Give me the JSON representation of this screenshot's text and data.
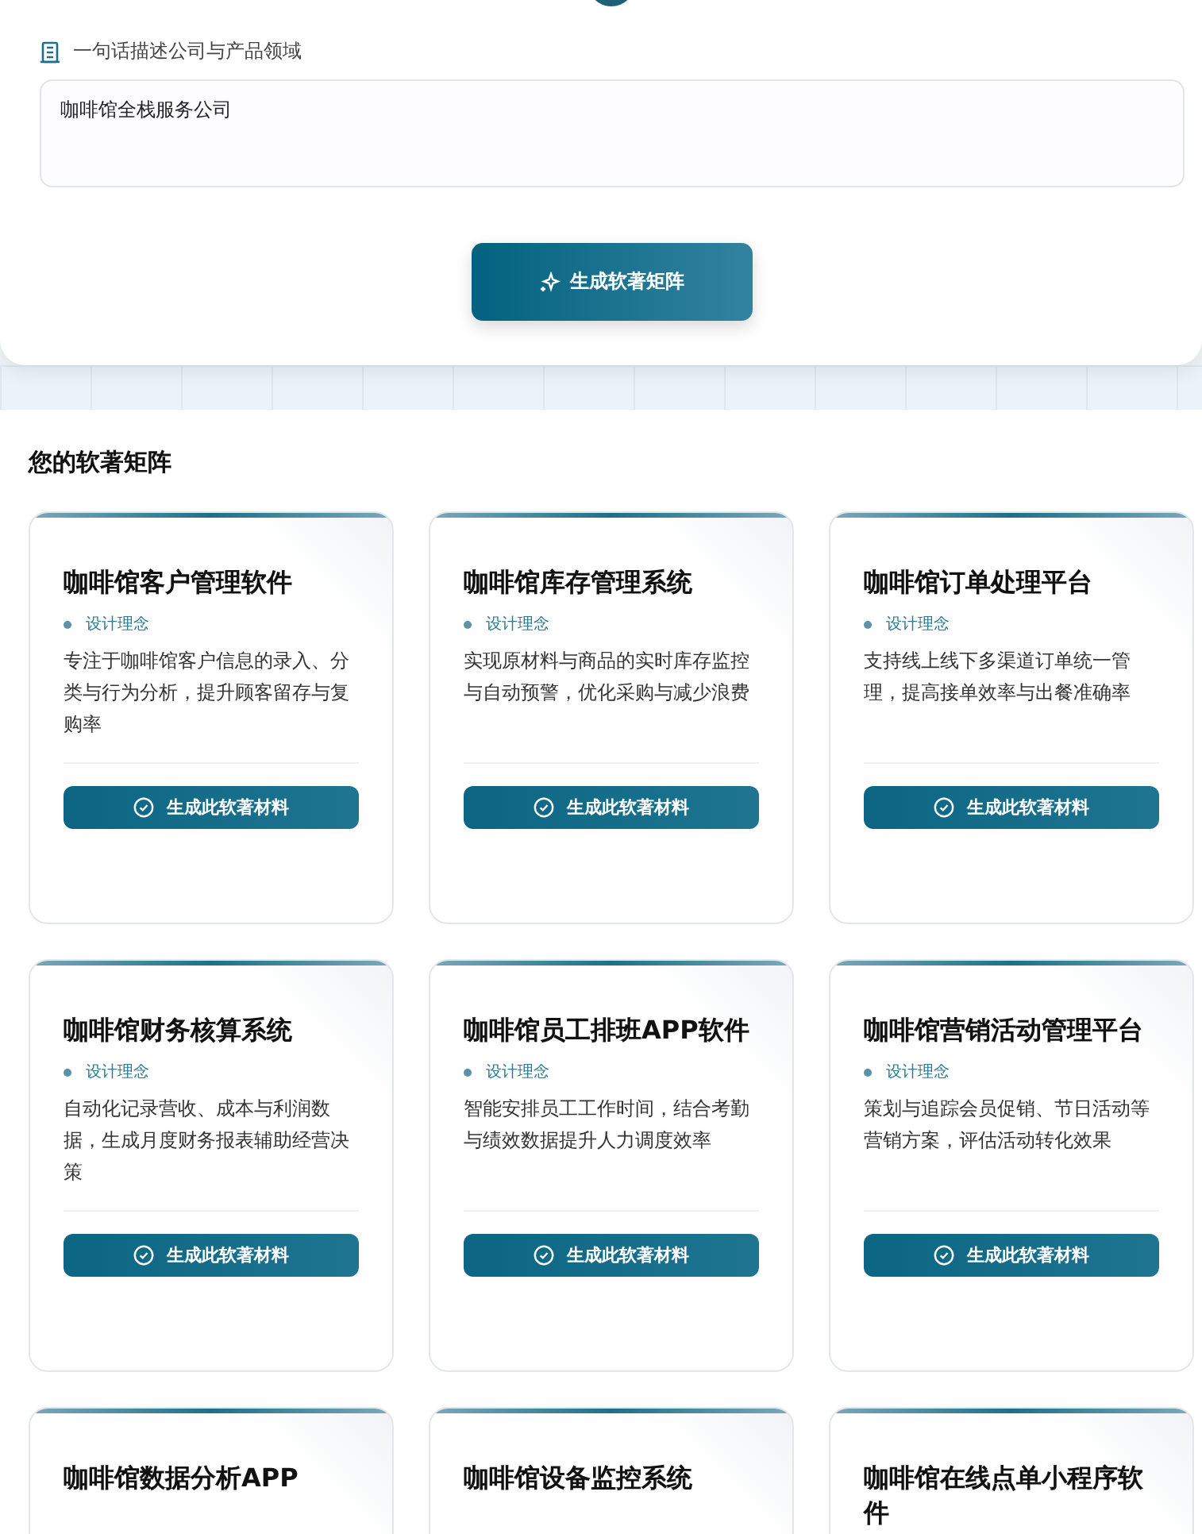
{
  "form": {
    "label": "一句话描述公司与产品领域",
    "value": "咖啡馆全栈服务公司",
    "submit": "生成软著矩阵"
  },
  "matrix": {
    "heading": "您的软著矩阵",
    "cards": [
      {
        "title": "咖啡馆客户管理软件",
        "tag": "设计理念",
        "description": "专注于咖啡馆客户信息的录入、分类与行为分析，提升顾客留存与复购率",
        "action": "生成此软著材料"
      },
      {
        "title": "咖啡馆库存管理系统",
        "tag": "设计理念",
        "description": "实现原材料与商品的实时库存监控与自动预警，优化采购与减少浪费",
        "action": "生成此软著材料"
      },
      {
        "title": "咖啡馆订单处理平台",
        "tag": "设计理念",
        "description": "支持线上线下多渠道订单统一管理，提高接单效率与出餐准确率",
        "action": "生成此软著材料"
      },
      {
        "title": "咖啡馆财务核算系统",
        "tag": "设计理念",
        "description": "自动化记录营收、成本与利润数据，生成月度财务报表辅助经营决策",
        "action": "生成此软著材料"
      },
      {
        "title": "咖啡馆员工排班APP软件",
        "tag": "设计理念",
        "description": "智能安排员工工作时间，结合考勤与绩效数据提升人力调度效率",
        "action": "生成此软著材料"
      },
      {
        "title": "咖啡馆营销活动管理平台",
        "tag": "设计理念",
        "description": "策划与追踪会员促销、节日活动等营销方案，评估活动转化效果",
        "action": "生成此软著材料"
      },
      {
        "title": "咖啡馆数据分析APP"
      },
      {
        "title": "咖啡馆设备监控系统"
      },
      {
        "title": "咖啡馆在线点单小程序软件"
      }
    ]
  }
}
